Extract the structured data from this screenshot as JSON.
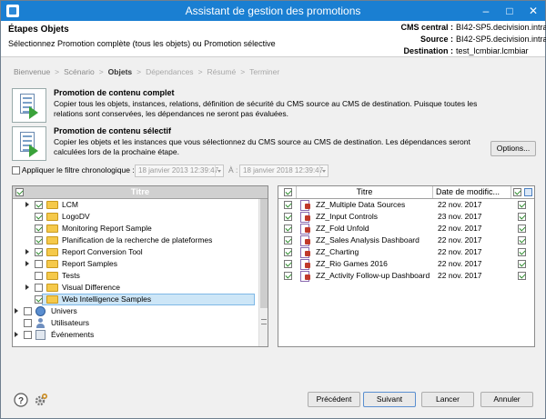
{
  "window": {
    "title": "Assistant de gestion des promotions"
  },
  "header": {
    "step_title": "Étapes Objets",
    "subtitle": "Sélectionnez Promotion complète (tous les objets) ou Promotion sélective",
    "cms_central_label": "CMS central :",
    "cms_central_value": "BI42-SP5.decivision.intra",
    "source_label": "Source :",
    "source_value": "BI42-SP5.decivision.intra",
    "destination_label": "Destination :",
    "destination_value": "test_lcmbiar.lcmbiar"
  },
  "breadcrumb": [
    "Bienvenue",
    "Scénario",
    "Objets",
    "Dépendances",
    "Résumé",
    "Terminer"
  ],
  "breadcrumb_separator": ">",
  "breadcrumb_current_index": 2,
  "options": {
    "full": {
      "title": "Promotion de contenu complet",
      "desc": "Copier tous les objets, instances, relations, définition de sécurité du CMS source au CMS de destination. Puisque toutes les relations sont conservées, les dépendances ne seront pas évaluées."
    },
    "selective": {
      "title": "Promotion de contenu sélectif",
      "desc": "Copier les objets et les instances que vous sélectionnez du CMS source au CMS de destination. Les dépendances seront calculées lors de la prochaine étape.",
      "options_button": "Options..."
    }
  },
  "filter": {
    "label": "Appliquer le filtre chronologique :",
    "from_value": "18 janvier 2013 12:39:47",
    "to_label": "À :",
    "to_value": "18 janvier 2018 12:39:47"
  },
  "left_tree": {
    "header": "Titre",
    "items": [
      {
        "label": "LCM",
        "level": 2,
        "expand": true,
        "checked": true,
        "icon": "folder-icon"
      },
      {
        "label": "LogoDV",
        "level": 2,
        "expand": false,
        "checked": true,
        "icon": "folder-icon"
      },
      {
        "label": "Monitoring Report Sample",
        "level": 2,
        "expand": false,
        "checked": true,
        "icon": "folder-icon"
      },
      {
        "label": "Planification de la recherche de plateformes",
        "level": 2,
        "expand": false,
        "checked": true,
        "icon": "folder-icon"
      },
      {
        "label": "Report Conversion Tool",
        "level": 2,
        "expand": true,
        "checked": true,
        "icon": "folder-icon"
      },
      {
        "label": "Report Samples",
        "level": 2,
        "expand": true,
        "checked": false,
        "icon": "folder-icon"
      },
      {
        "label": "Tests",
        "level": 2,
        "expand": false,
        "checked": false,
        "icon": "folder-icon"
      },
      {
        "label": "Visual Difference",
        "level": 2,
        "expand": true,
        "checked": false,
        "icon": "folder-icon"
      },
      {
        "label": "Web Intelligence Samples",
        "level": 2,
        "expand": false,
        "checked": true,
        "icon": "folder-icon",
        "selected": true
      },
      {
        "label": "Univers",
        "level": 1,
        "expand": true,
        "checked": false,
        "icon": "universe-icon"
      },
      {
        "label": "Utilisateurs",
        "level": 1,
        "expand": false,
        "checked": false,
        "icon": "users-icon"
      },
      {
        "label": "Événements",
        "level": 1,
        "expand": true,
        "checked": false,
        "icon": "events-icon"
      }
    ]
  },
  "right_table": {
    "columns": [
      "Titre",
      "Date de modific..."
    ],
    "rows": [
      {
        "title": "ZZ_Multiple Data Sources",
        "date": "22 nov. 2017"
      },
      {
        "title": "ZZ_Input Controls",
        "date": "23 nov. 2017"
      },
      {
        "title": "ZZ_Fold Unfold",
        "date": "22 nov. 2017"
      },
      {
        "title": "ZZ_Sales Analysis Dashboard",
        "date": "22 nov. 2017"
      },
      {
        "title": "ZZ_Charting",
        "date": "22 nov. 2017"
      },
      {
        "title": "ZZ_Rio Games 2016",
        "date": "22 nov. 2017"
      },
      {
        "title": "ZZ_Activity Follow-up Dashboard",
        "date": "22 nov. 2017"
      }
    ]
  },
  "footer": {
    "prev": "Précédent",
    "next": "Suivant",
    "cancel": "Lancer",
    "close": "Annuler"
  },
  "colors": {
    "titlebar": "#1a7fd2",
    "selection": "#cde6f7",
    "check": "#2a8a2a"
  }
}
